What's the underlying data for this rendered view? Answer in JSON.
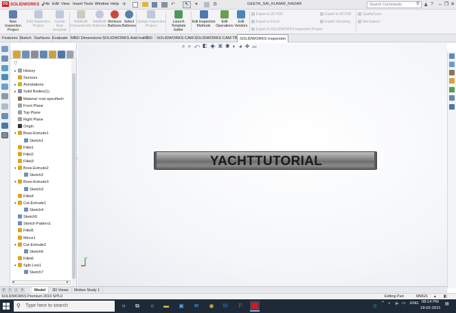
{
  "app": {
    "logo_text": "SOLIDWORKS",
    "logo_mark": "DS",
    "document_title": "GEETA_SAI_KUMAR_RADAR"
  },
  "menu": [
    "File",
    "Edit",
    "View",
    "Insert",
    "Tools",
    "Window",
    "Help"
  ],
  "search": {
    "placeholder": "Search Commands"
  },
  "toolbar": {
    "buttons": [
      {
        "label_1": "New Inspection",
        "label_2": "Project",
        "enabled": true
      },
      {
        "label_1": "Edit Inspection",
        "label_2": "Project",
        "enabled": false
      },
      {
        "label_1": "Create New",
        "label_2": "template",
        "enabled": false
      },
      {
        "label_1": "Add/Edit",
        "label_2": "Characteristic",
        "enabled": false
      },
      {
        "label_1": "Add/Edit",
        "label_2": "Balloons",
        "enabled": false
      },
      {
        "label_1": "Remove",
        "label_2": "Balloons",
        "enabled": true
      },
      {
        "label_1": "Select",
        "label_2": "Balloons",
        "enabled": true
      },
      {
        "label_1": "Update Inspection",
        "label_2": "Project",
        "enabled": false
      },
      {
        "label_1": "Launch",
        "label_2": "Template Editor",
        "enabled": true
      },
      {
        "label_1": "Edit Inspection",
        "label_2": "Methods",
        "enabled": true
      },
      {
        "label_1": "Edit",
        "label_2": "Operations",
        "enabled": true
      },
      {
        "label_1": "Edit",
        "label_2": "Vendors",
        "enabled": true
      }
    ],
    "export": [
      "Export to 2D PDF",
      "Export to Excel",
      "Export to SOLIDWORKS Inspection Project"
    ],
    "export_right": [
      "Export to 3D PDF",
      "Export eDrawing"
    ],
    "quality": [
      "QualityXpert",
      "Net-Inspect"
    ]
  },
  "tabs": [
    "Features",
    "Sketch",
    "Surfaces",
    "Evaluate",
    "MBD Dimensions",
    "SOLIDWORKS Add-Ins",
    "MBD",
    "SOLIDWORKS CAM",
    "SOLIDWORKS CAM TBM",
    "SOLIDWORKS Inspection"
  ],
  "active_tab": "SOLIDWORKS Inspection",
  "feature_tree": [
    {
      "label": "History",
      "indent": 0,
      "arrow": "▸",
      "icon": "history-icon",
      "color": "#9aa3ad"
    },
    {
      "label": "Sensors",
      "indent": 0,
      "arrow": "",
      "icon": "sensor-icon",
      "color": "#e0a21e"
    },
    {
      "label": "Annotations",
      "indent": 0,
      "arrow": "▸",
      "icon": "annotation-icon",
      "color": "#d2b01a"
    },
    {
      "label": "Solid Bodies(1)",
      "indent": 0,
      "arrow": "▸",
      "icon": "solid-bodies-icon",
      "color": "#8e98a3"
    },
    {
      "label": "Material <not specified>",
      "indent": 0,
      "arrow": "",
      "icon": "material-icon",
      "color": "#8a6d4f"
    },
    {
      "label": "Front Plane",
      "indent": 0,
      "arrow": "",
      "icon": "plane-icon",
      "color": "#9aa3ad"
    },
    {
      "label": "Top Plane",
      "indent": 0,
      "arrow": "",
      "icon": "plane-icon",
      "color": "#9aa3ad"
    },
    {
      "label": "Right Plane",
      "indent": 0,
      "arrow": "",
      "icon": "plane-icon",
      "color": "#9aa3ad"
    },
    {
      "label": "Origin",
      "indent": 0,
      "arrow": "",
      "icon": "origin-icon",
      "color": "#333333"
    },
    {
      "label": "Boss-Extrude1",
      "indent": 0,
      "arrow": "▾",
      "icon": "extrude-icon",
      "color": "#e0a21e"
    },
    {
      "label": "Sketch1",
      "indent": 1,
      "arrow": "",
      "icon": "sketch-icon",
      "color": "#6f8fb8"
    },
    {
      "label": "Fillet1",
      "indent": 0,
      "arrow": "",
      "icon": "fillet-icon",
      "color": "#e0a21e"
    },
    {
      "label": "Fillet2",
      "indent": 0,
      "arrow": "",
      "icon": "fillet-icon",
      "color": "#e0a21e"
    },
    {
      "label": "Fillet3",
      "indent": 0,
      "arrow": "",
      "icon": "fillet-icon",
      "color": "#e0a21e"
    },
    {
      "label": "Boss-Extrude2",
      "indent": 0,
      "arrow": "▾",
      "icon": "extrude-icon",
      "color": "#e0a21e"
    },
    {
      "label": "Sketch2",
      "indent": 1,
      "arrow": "",
      "icon": "sketch-icon",
      "color": "#6f8fb8"
    },
    {
      "label": "Boss-Extrude3",
      "indent": 0,
      "arrow": "▾",
      "icon": "extrude-icon",
      "color": "#e0a21e"
    },
    {
      "label": "Sketch3",
      "indent": 1,
      "arrow": "",
      "icon": "sketch-icon",
      "color": "#6f8fb8"
    },
    {
      "label": "Fillet4",
      "indent": 0,
      "arrow": "",
      "icon": "fillet-icon",
      "color": "#e0a21e"
    },
    {
      "label": "Cut-Extrude1",
      "indent": 0,
      "arrow": "▾",
      "icon": "cut-icon",
      "color": "#e0a21e"
    },
    {
      "label": "Sketch4",
      "indent": 1,
      "arrow": "",
      "icon": "sketch-icon",
      "color": "#6f8fb8"
    },
    {
      "label": "Sketch5",
      "indent": 0,
      "arrow": "",
      "icon": "sketch-icon",
      "color": "#6f8fb8"
    },
    {
      "label": "Sketch-Pattern1",
      "indent": 0,
      "arrow": "",
      "icon": "pattern-icon",
      "color": "#6f8fb8"
    },
    {
      "label": "Fillet5",
      "indent": 0,
      "arrow": "",
      "icon": "fillet-icon",
      "color": "#e0a21e"
    },
    {
      "label": "Mirror1",
      "indent": 0,
      "arrow": "",
      "icon": "mirror-icon",
      "color": "#e0a21e"
    },
    {
      "label": "Cut-Extrude2",
      "indent": 0,
      "arrow": "▾",
      "icon": "cut-icon",
      "color": "#e0a21e"
    },
    {
      "label": "Sketch6",
      "indent": 1,
      "arrow": "",
      "icon": "sketch-icon",
      "color": "#6f8fb8"
    },
    {
      "label": "Fillet6",
      "indent": 0,
      "arrow": "",
      "icon": "fillet-icon",
      "color": "#e0a21e"
    },
    {
      "label": "Split Line1",
      "indent": 0,
      "arrow": "▾",
      "icon": "split-line-icon",
      "color": "#e0a21e"
    },
    {
      "label": "Sketch7",
      "indent": 1,
      "arrow": "",
      "icon": "sketch-icon",
      "color": "#6f8fb8"
    }
  ],
  "model": {
    "part_text": "YACHTTUTORIAL"
  },
  "bottom_tabs": [
    "Model",
    "3D Views",
    "Motion Study 1"
  ],
  "status": {
    "product": "SOLIDWORKS Premium 2019 SP5.0",
    "mode": "Editing Part",
    "units": "MMGS"
  },
  "taskbar": {
    "search_placeholder": "Type here to search",
    "language": "ENG",
    "time": "08:14 PM",
    "date": "18-02-2021"
  }
}
